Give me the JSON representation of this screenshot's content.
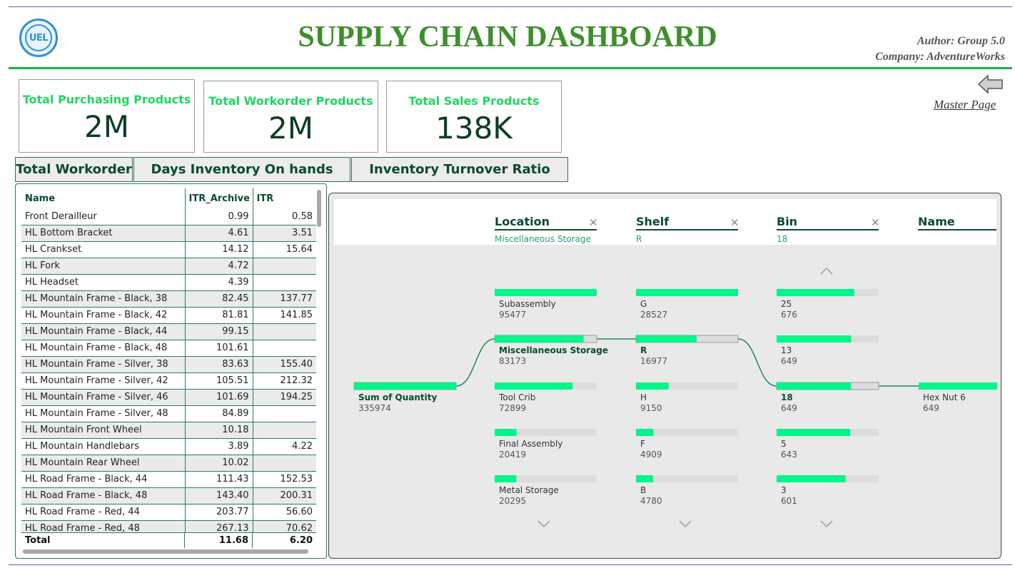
{
  "header": {
    "logo_text": "UEL",
    "title": "SUPPLY CHAIN DASHBOARD",
    "author": "Author: Group 5.0",
    "company": "Company: AdventureWorks"
  },
  "kpis": [
    {
      "title": "Total Purchasing Products",
      "value": "2M"
    },
    {
      "title": "Total Workorder Products",
      "value": "2M"
    },
    {
      "title": "Total Sales Products",
      "value": "138K"
    }
  ],
  "nav": {
    "back_icon": "left-arrow-icon",
    "master_link": "Master Page"
  },
  "tabs": [
    "Total Workorder",
    "Days Inventory On hands",
    "Inventory Turnover Ratio"
  ],
  "table": {
    "columns": [
      "Name",
      "ITR_Archive",
      "ITR"
    ],
    "rows": [
      [
        "Front Derailleur",
        "0.99",
        "0.58"
      ],
      [
        "HL Bottom Bracket",
        "4.61",
        "3.51"
      ],
      [
        "HL Crankset",
        "14.12",
        "15.64"
      ],
      [
        "HL Fork",
        "4.72",
        ""
      ],
      [
        "HL Headset",
        "4.39",
        ""
      ],
      [
        "HL Mountain Frame - Black, 38",
        "82.45",
        "137.77"
      ],
      [
        "HL Mountain Frame - Black, 42",
        "81.81",
        "141.85"
      ],
      [
        "HL Mountain Frame - Black, 44",
        "99.15",
        ""
      ],
      [
        "HL Mountain Frame - Black, 48",
        "101.61",
        ""
      ],
      [
        "HL Mountain Frame - Silver, 38",
        "83.63",
        "155.40"
      ],
      [
        "HL Mountain Frame - Silver, 42",
        "105.51",
        "212.32"
      ],
      [
        "HL Mountain Frame - Silver, 46",
        "101.69",
        "194.25"
      ],
      [
        "HL Mountain Frame - Silver, 48",
        "84.89",
        ""
      ],
      [
        "HL Mountain Front Wheel",
        "10.18",
        ""
      ],
      [
        "HL Mountain Handlebars",
        "3.89",
        "4.22"
      ],
      [
        "HL Mountain Rear Wheel",
        "10.02",
        ""
      ],
      [
        "HL Road Frame - Black, 44",
        "111.43",
        "152.53"
      ],
      [
        "HL Road Frame - Black, 48",
        "143.40",
        "200.31"
      ],
      [
        "HL Road Frame - Red, 44",
        "203.77",
        "56.60"
      ],
      [
        "HL Road Frame - Red, 48",
        "267.13",
        "70.62"
      ]
    ],
    "total": [
      "Total",
      "11.68",
      "6.20"
    ]
  },
  "tree": {
    "levels": [
      {
        "name": "Location",
        "selected": "Miscellaneous Storage"
      },
      {
        "name": "Shelf",
        "selected": "R"
      },
      {
        "name": "Bin",
        "selected": "18"
      },
      {
        "name": "Name",
        "selected": ""
      }
    ],
    "colors": {
      "bar": "#00f58a",
      "track": "#dcdcdc",
      "link": "#1b8a55"
    },
    "root": {
      "label": "Sum of Quantity",
      "value": 335974
    },
    "location_nodes": [
      {
        "label": "Subassembly",
        "value": 95477
      },
      {
        "label": "Miscellaneous Storage",
        "value": 83173,
        "selected": true
      },
      {
        "label": "Tool Crib",
        "value": 72899
      },
      {
        "label": "Final Assembly",
        "value": 20419
      },
      {
        "label": "Metal Storage",
        "value": 20295
      }
    ],
    "shelf_nodes": [
      {
        "label": "G",
        "value": 28527
      },
      {
        "label": "R",
        "value": 16977,
        "selected": true
      },
      {
        "label": "H",
        "value": 9150
      },
      {
        "label": "F",
        "value": 4909
      },
      {
        "label": "B",
        "value": 4780
      }
    ],
    "bin_nodes": [
      {
        "label": "25",
        "value": 676
      },
      {
        "label": "13",
        "value": 649
      },
      {
        "label": "18",
        "value": 649,
        "selected": true
      },
      {
        "label": "5",
        "value": 643
      },
      {
        "label": "3",
        "value": 601
      }
    ],
    "name_nodes": [
      {
        "label": "Hex Nut 6",
        "value": 649
      }
    ]
  }
}
